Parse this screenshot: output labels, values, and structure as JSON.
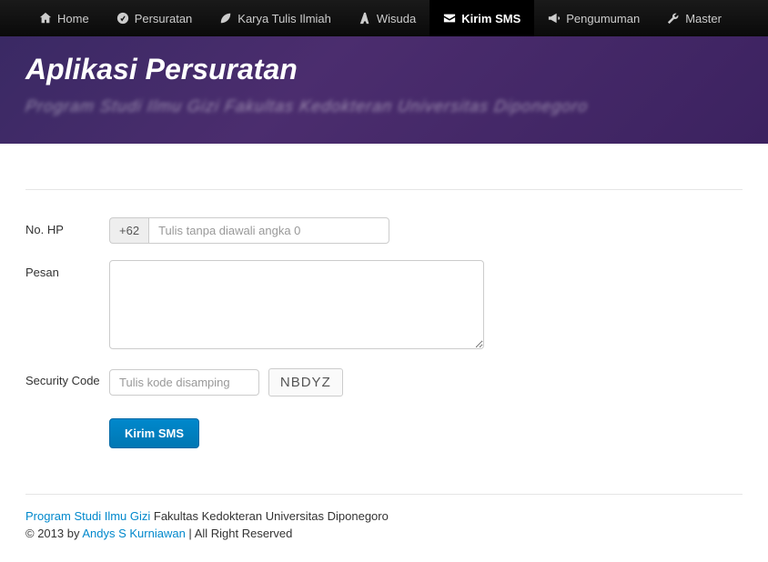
{
  "nav": {
    "items": [
      {
        "label": "Home"
      },
      {
        "label": "Persuratan"
      },
      {
        "label": "Karya Tulis Ilmiah"
      },
      {
        "label": "Wisuda"
      },
      {
        "label": "Kirim SMS"
      },
      {
        "label": "Pengumuman"
      },
      {
        "label": "Master"
      }
    ]
  },
  "header": {
    "title": "Aplikasi Persuratan",
    "subtitle": "Program Studi Ilmu Gizi Fakultas Kedokteran Universitas Diponegoro"
  },
  "form": {
    "no_hp_label": "No. HP",
    "no_hp_prefix": "+62",
    "no_hp_placeholder": "Tulis tanpa diawali angka 0",
    "pesan_label": "Pesan",
    "security_label": "Security Code",
    "security_placeholder": "Tulis kode disamping",
    "captcha_value": "NBDYZ",
    "submit_label": "Kirim SMS"
  },
  "footer": {
    "link1": "Program Studi Ilmu Gizi",
    "text1": " Fakultas Kedokteran Universitas Diponegoro",
    "text2a": "© 2013 by ",
    "link2": "Andys S Kurniawan",
    "text2b": " | All Right Reserved"
  }
}
